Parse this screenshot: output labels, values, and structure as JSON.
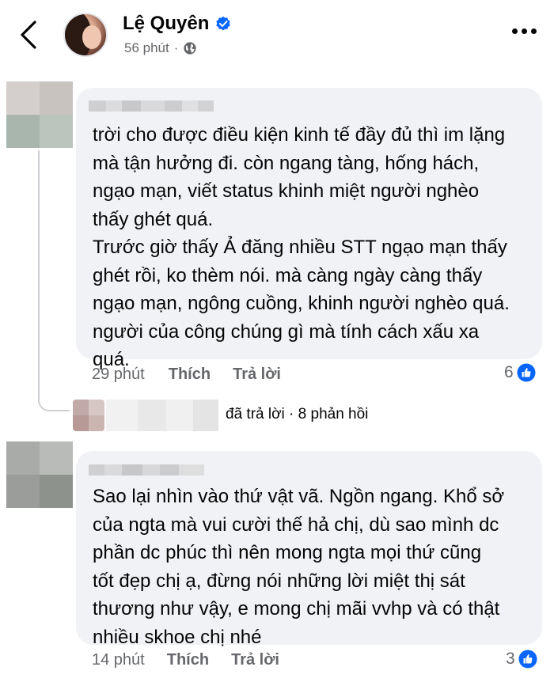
{
  "header": {
    "name": "Lệ Quyên",
    "time": "56 phút",
    "separator": "·"
  },
  "comments": [
    {
      "text": "trời cho được điều kiện kinh tế đầy đủ thì im lặng\nmà tận hưởng đi. còn ngang tàng, hống hách,\nngạo mạn, viết status khinh miệt người nghèo\nthấy ghét quá.\nTrước giờ thấy Ả đăng nhiều STT ngạo mạn thấy\nghét rồi, ko thèm nói. mà càng ngày càng thấy\nngạo mạn, ngông cuồng, khinh người nghèo quá.\nngười của công chúng gì mà tính cách xấu xa\nquá.",
      "time": "29 phút",
      "like_label": "Thích",
      "reply_label": "Trả lời",
      "reaction_count": "6"
    },
    {
      "text": "Sao lại nhìn vào thứ vật vã. Ngồn ngang. Khổ sở\ncủa ngta mà vui cười thế hả chị, dù sao mình dc\nphần dc phúc thì nên mong ngta mọi thứ cũng\ntốt đẹp chị ạ, đừng nói những lời miệt thị sát\nthương như vậy, e mong chị mãi vvhp và có thật\nnhiều skhoe chị nhé",
      "time": "14 phút",
      "like_label": "Thích",
      "reply_label": "Trả lời",
      "reaction_count": "3"
    }
  ],
  "reply_summary": {
    "text": "đã trả lời · 8 phản hồi"
  },
  "icons": {
    "back": "chevron-left-icon",
    "verified": "verified-badge-icon",
    "audience": "globe-icon",
    "more": "more-icon",
    "like": "like-reaction-icon"
  },
  "colors": {
    "bubble": "#f0f2f5",
    "verified": "#0866ff",
    "secondary_text": "#65676b"
  }
}
